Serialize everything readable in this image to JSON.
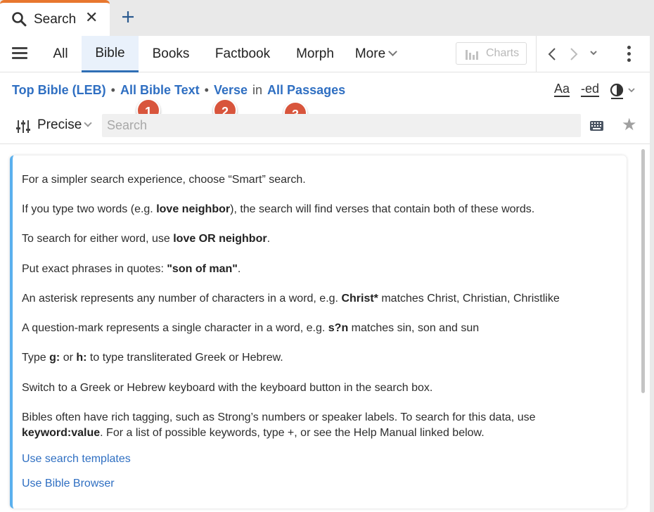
{
  "tab": {
    "title": "Search",
    "close": "✕",
    "new_tab": "+"
  },
  "nav": {
    "tabs": [
      {
        "label": "All"
      },
      {
        "label": "Bible"
      },
      {
        "label": "Books"
      },
      {
        "label": "Factbook"
      },
      {
        "label": "Morph"
      },
      {
        "label": "More"
      }
    ],
    "active": "Bible",
    "charts_label": "Charts"
  },
  "breadcrumb": {
    "bible": "Top Bible (LEB)",
    "sep": "•",
    "scope": "All Bible Text",
    "unit": "Verse",
    "in": "in",
    "range": "All Passages"
  },
  "format_icons": {
    "font_size": "Aa",
    "spelling": "-ed"
  },
  "markers": [
    "1",
    "2",
    "3"
  ],
  "search": {
    "mode": "Precise",
    "placeholder": "Search",
    "value": ""
  },
  "help": {
    "line1": "For a simpler search experience, choose “Smart” search.",
    "line2_pre": "If you type two words (e.g. ",
    "line2_bold": "love neighbor",
    "line2_post": "), the search will find verses that contain both of these words.",
    "line3_pre": "To search for either word, use ",
    "line3_bold": "love OR neighbor",
    "line3_post": ".",
    "line4_pre": "Put exact phrases in quotes: ",
    "line4_bold": "\"son of man\"",
    "line4_post": ".",
    "line5_pre": "An asterisk represents any number of characters in a word, e.g. ",
    "line5_bold": "Christ*",
    "line5_post": " matches Christ, Christian, Christlike",
    "line6_pre": "A question-mark represents a single character in a word, e.g. ",
    "line6_bold": "s?n",
    "line6_post": " matches sin, son and sun",
    "line7_pre": "Type ",
    "line7_bold1": "g:",
    "line7_mid": " or ",
    "line7_bold2": "h:",
    "line7_post": " to type transliterated Greek or Hebrew.",
    "line8": "Switch to a Greek or Hebrew keyboard with the keyboard button in the search box.",
    "line9a": "Bibles often have rich tagging, such as Strong’s numbers or speaker labels. To search for this data, use",
    "line9b_bold": "keyword:value",
    "line9b_post": ". For a list of possible keywords, type +, or see the Help Manual linked below.",
    "link1": "Use search templates",
    "link2": "Use Bible Browser"
  },
  "colors": {
    "accent_tab": "#e8772e",
    "link": "#2f6fc2",
    "active_tab_bar": "#2f6fb5",
    "card_border": "#5ab0ee",
    "marker": "#d8553c"
  },
  "icons": [
    "search-icon",
    "close-icon",
    "plus-icon",
    "hamburger-icon",
    "chevron-down-icon",
    "bar-chart-icon",
    "chevron-left-icon",
    "chevron-right-icon",
    "kebab-icon",
    "font-size-icon",
    "spelling-icon",
    "contrast-icon",
    "sliders-icon",
    "keyboard-icon",
    "star-icon"
  ]
}
